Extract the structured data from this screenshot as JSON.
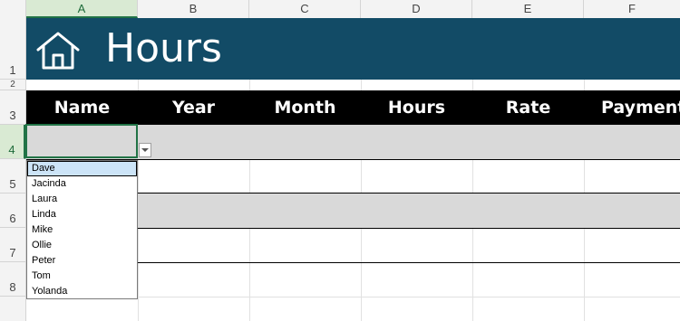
{
  "columns": [
    "A",
    "B",
    "C",
    "D",
    "E",
    "F"
  ],
  "rows": [
    "1",
    "2",
    "3",
    "4",
    "5",
    "6",
    "7",
    "8"
  ],
  "banner": {
    "title": "Hours",
    "icon": "home-icon",
    "background": "#124b66"
  },
  "table_headers": [
    "Name",
    "Year",
    "Month",
    "Hours",
    "Rate",
    "Payment"
  ],
  "dropdown": {
    "selected": "Dave",
    "items": [
      "Dave",
      "Jacinda",
      "Laura",
      "Linda",
      "Mike",
      "Ollie",
      "Peter",
      "Tom",
      "Yolanda"
    ]
  },
  "colors": {
    "header_bg": "#000000",
    "band": "#d9d9d9",
    "selection": "#217346",
    "list_highlight": "#cce4f7"
  }
}
